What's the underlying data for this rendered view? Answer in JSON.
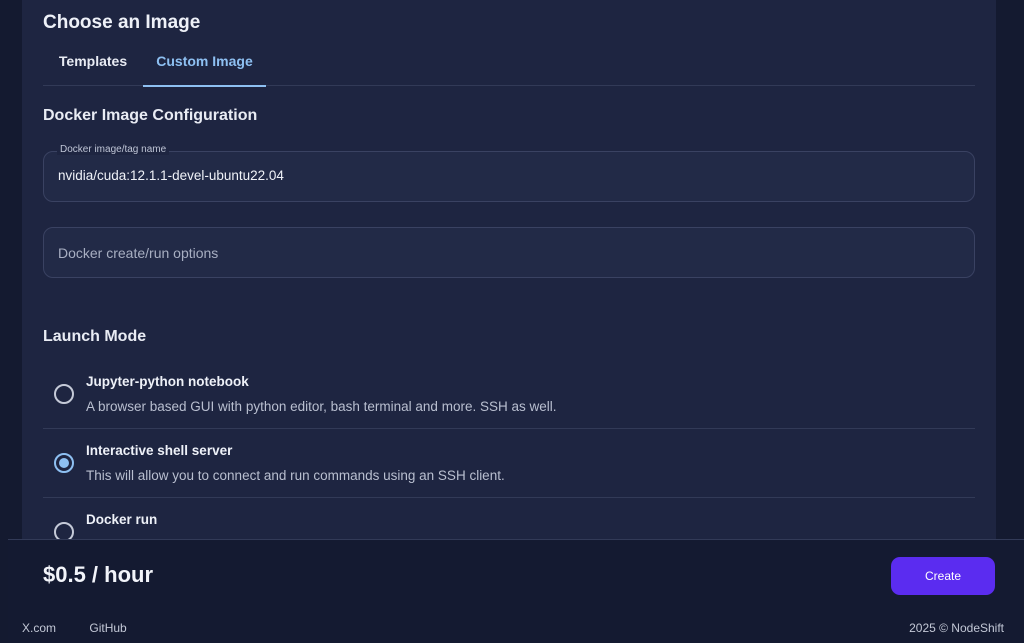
{
  "page": {
    "title": "Choose an Image",
    "tabs": [
      {
        "label": "Templates",
        "active": false
      },
      {
        "label": "Custom Image",
        "active": true
      }
    ]
  },
  "docker_config": {
    "section_title": "Docker Image Configuration",
    "image_field": {
      "label": "Docker image/tag name",
      "value": "nvidia/cuda:12.1.1-devel-ubuntu22.04"
    },
    "options_field": {
      "placeholder": "Docker create/run options",
      "value": ""
    }
  },
  "launch_mode": {
    "section_title": "Launch Mode",
    "options": [
      {
        "title": "Jupyter-python notebook",
        "description": "A browser based GUI with python editor, bash terminal and more. SSH as well.",
        "selected": false
      },
      {
        "title": "Interactive shell server",
        "description": "This will allow you to connect and run commands using an SSH client.",
        "selected": true
      },
      {
        "title": "Docker run",
        "description": "",
        "selected": false
      }
    ]
  },
  "footer": {
    "price": "$0.5 / hour",
    "create_label": "Create",
    "links": [
      "X.com",
      "GitHub"
    ],
    "copyright": "2025 © NodeShift"
  },
  "colors": {
    "accent": "#8ec0f2",
    "primary_button": "#5b2cf0",
    "background": "#1e2541"
  }
}
